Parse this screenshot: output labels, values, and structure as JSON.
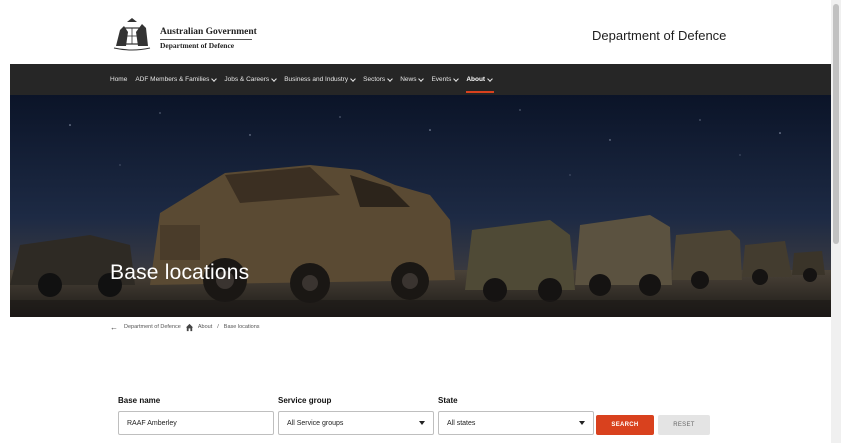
{
  "header": {
    "gov_name": "Australian Government",
    "gov_dept": "Department of Defence",
    "site_title": "Department of Defence"
  },
  "nav": {
    "items": [
      {
        "label": "Home",
        "dropdown": false
      },
      {
        "label": "ADF Members & Families",
        "dropdown": true
      },
      {
        "label": "Jobs & Careers",
        "dropdown": true
      },
      {
        "label": "Business and Industry",
        "dropdown": true
      },
      {
        "label": "Sectors",
        "dropdown": true
      },
      {
        "label": "News",
        "dropdown": true
      },
      {
        "label": "Events",
        "dropdown": true
      },
      {
        "label": "About",
        "dropdown": true,
        "active": true
      }
    ]
  },
  "hero": {
    "title": "Base locations"
  },
  "breadcrumb": {
    "items": [
      "Department of Defence",
      "About",
      "Base locations"
    ]
  },
  "search": {
    "base_name_label": "Base name",
    "base_name_value": "RAAF Amberley",
    "service_group_label": "Service group",
    "service_group_value": "All Service groups",
    "state_label": "State",
    "state_value": "All states",
    "search_button": "SEARCH",
    "reset_button": "RESET"
  },
  "colors": {
    "accent": "#d9411e",
    "nav_bg": "#262626"
  }
}
